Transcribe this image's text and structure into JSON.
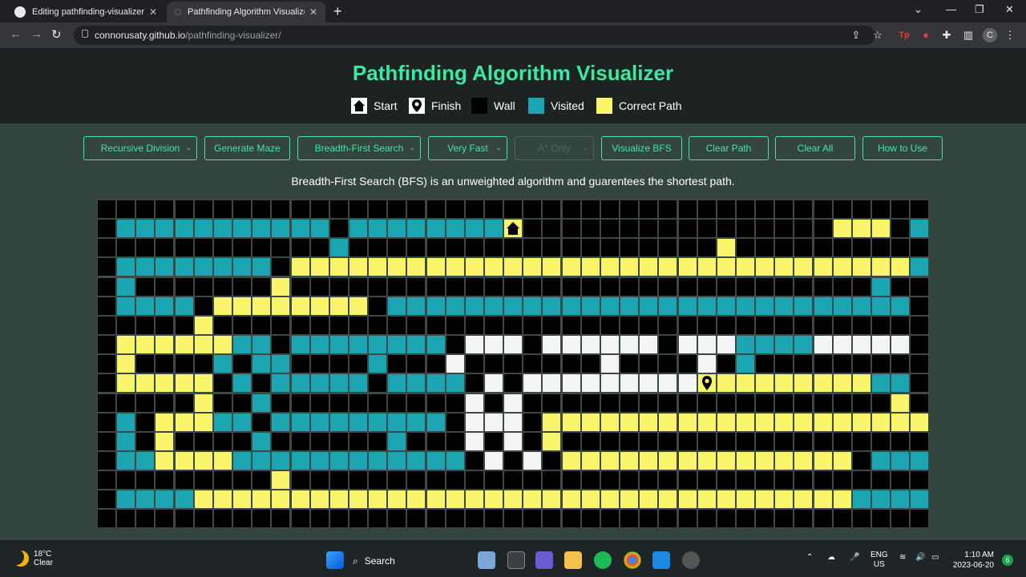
{
  "browser": {
    "tabs": [
      {
        "title": "Editing pathfinding-visualizer/RE"
      },
      {
        "title": "Pathfinding Algorithm Visualizer"
      }
    ],
    "url_host": "connorusaty.github.io",
    "url_path": "/pathfinding-visualizer/",
    "profile_initial": "C"
  },
  "page": {
    "title": "Pathfinding Algorithm Visualizer",
    "legend": {
      "start": "Start",
      "finish": "Finish",
      "wall": "Wall",
      "visited": "Visited",
      "path": "Correct Path"
    },
    "controls": {
      "maze_select": "Recursive Division",
      "generate_maze": "Generate Maze",
      "algorithm_select": "Breadth-First Search",
      "speed_select": "Very Fast",
      "heuristic_select": "A* Only",
      "visualize": "Visualize BFS",
      "clear_path": "Clear Path",
      "clear_all": "Clear All",
      "how_to_use": "How to Use"
    },
    "description": "Breadth-First Search (BFS) is an unweighted algorithm and guarentees the shortest path.",
    "colors": {
      "wall": "#000000",
      "visited": "#1ba5b3",
      "path": "#faf56b",
      "empty": "#f4f4f4",
      "accent": "#3ee8a4"
    },
    "grid": {
      "legend": [
        "#=wall",
        "v=visited",
        "p=correct path",
        ".=unvisited",
        "S=start",
        "F=finish"
      ],
      "rows": [
        "###########################################",
        "#vvvvvvvvvvv#vvvvvvvvS################ppp#vv#",
        "############v###################p##########",
        "#vvvvvvvv#ppppppppppppppppppppppppppppppppvv#",
        "#v#######p##############################v##v#",
        "#vvvv#pppppppp#vvvvvvvvvvvvvvvvvvvvvvvvvvv#v#",
        "#####p#####################################",
        "#ppppppvv#vvvvvvvv#...#......#...vvvv.....#",
        "#p####v#vv####v###.#######.####.#v########",
        "#ppppp#v#vvvvv#vvvv#.#.........Fppppppppvv#",
        "#####p##v##########.#.###################p#",
        "#v#pppvv#vvvvvvvvv#...#ppppppppppppppppppppvv#",
        "#v#p####v######v###.#.#p######################v#",
        "#vvppppvvvvvvvvvvvv#.#.#ppppppppppppppp#vvv#",
        "#########p###################################p##",
        "#vvvvppppppppppppppppppppppppppppppppppvvvv#",
        "###########################################"
      ]
    }
  },
  "taskbar": {
    "temperature": "18°C",
    "weather": "Clear",
    "search": "Search",
    "lang_top": "ENG",
    "lang_bottom": "US",
    "time": "1:10 AM",
    "date": "2023-06-20",
    "notifications": "6"
  }
}
